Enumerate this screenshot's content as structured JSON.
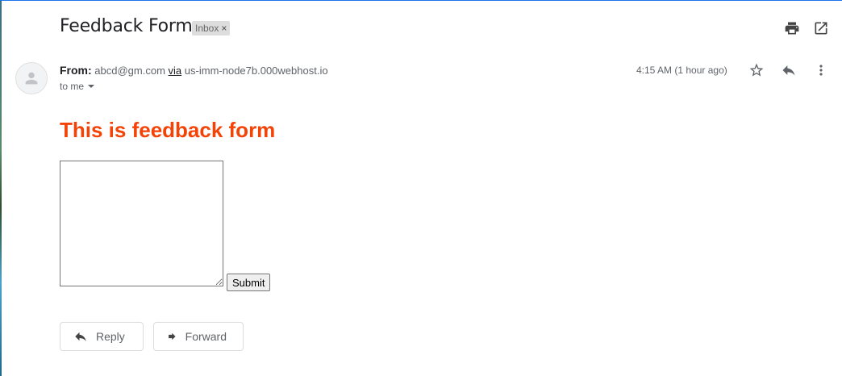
{
  "email": {
    "subject": "Feedback Form",
    "label_chip": "Inbox",
    "label_remove": "×",
    "from_label": "From:",
    "from_address": "abcd@gm.com",
    "via_label": "via",
    "via_host": "us-imm-node7b.000webhost.io",
    "to_label": "to me",
    "timestamp": "4:15 AM (1 hour ago)"
  },
  "body": {
    "heading": "This is feedback form",
    "textarea_value": "",
    "submit_label": "Submit"
  },
  "actions": {
    "reply_label": "Reply",
    "forward_label": "Forward"
  },
  "icons": [
    "print-icon",
    "open-in-new-window-icon",
    "avatar-person-icon",
    "dropdown-arrow-icon",
    "star-icon",
    "reply-icon",
    "more-vert-icon",
    "forward-icon"
  ],
  "colors": {
    "heading": "#f44307",
    "chip_bg": "#dddddd",
    "icon": "#5f6368"
  }
}
